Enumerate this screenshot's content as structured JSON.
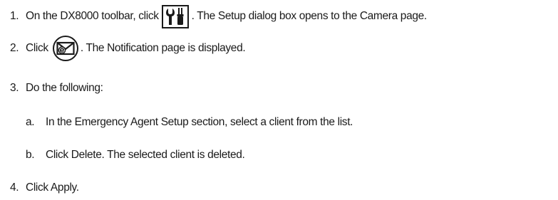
{
  "steps": [
    {
      "number": "1.",
      "text_before": "On the DX8000 toolbar, click",
      "icon": "wrench-screwdriver-setup-icon",
      "text_after": ". The Setup dialog box opens to the Camera page."
    },
    {
      "number": "2.",
      "text_before": "Click",
      "icon": "email-notification-icon",
      "text_after": ". The Notification page is displayed."
    },
    {
      "number": "3.",
      "text": "Do the following:",
      "substeps": [
        {
          "letter": "a.",
          "text": "In the Emergency Agent Setup section, select a client from the list."
        },
        {
          "letter": "b.",
          "text": "Click Delete. The selected client is deleted."
        }
      ]
    },
    {
      "number": "4.",
      "text": "Click Apply."
    }
  ]
}
